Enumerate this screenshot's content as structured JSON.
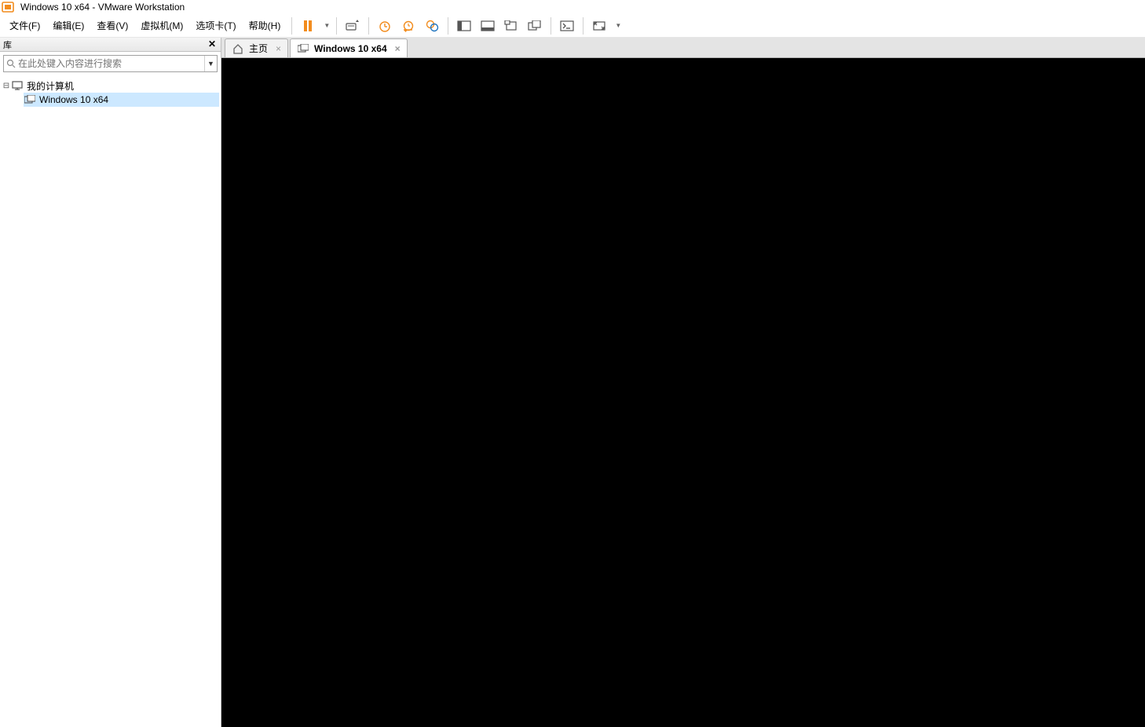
{
  "window": {
    "title": "Windows 10 x64 - VMware Workstation"
  },
  "menu": {
    "file": "文件(F)",
    "edit": "编辑(E)",
    "view": "查看(V)",
    "vm": "虚拟机(M)",
    "tabs": "选项卡(T)",
    "help": "帮助(H)"
  },
  "sidebar": {
    "title": "库",
    "search_placeholder": "在此处键入内容进行搜索",
    "tree": {
      "root_label": "我的计算机",
      "items": [
        {
          "label": "Windows 10 x64"
        }
      ]
    }
  },
  "tabs": {
    "home": "主页",
    "vm": "Windows 10 x64"
  },
  "colors": {
    "accent": "#f28c1d",
    "pause": "#f28c1d",
    "snapshot_clock": "#f28c1d",
    "snapshot_revert": "#f28c1d",
    "snapshot_manage": "#1e73be"
  }
}
